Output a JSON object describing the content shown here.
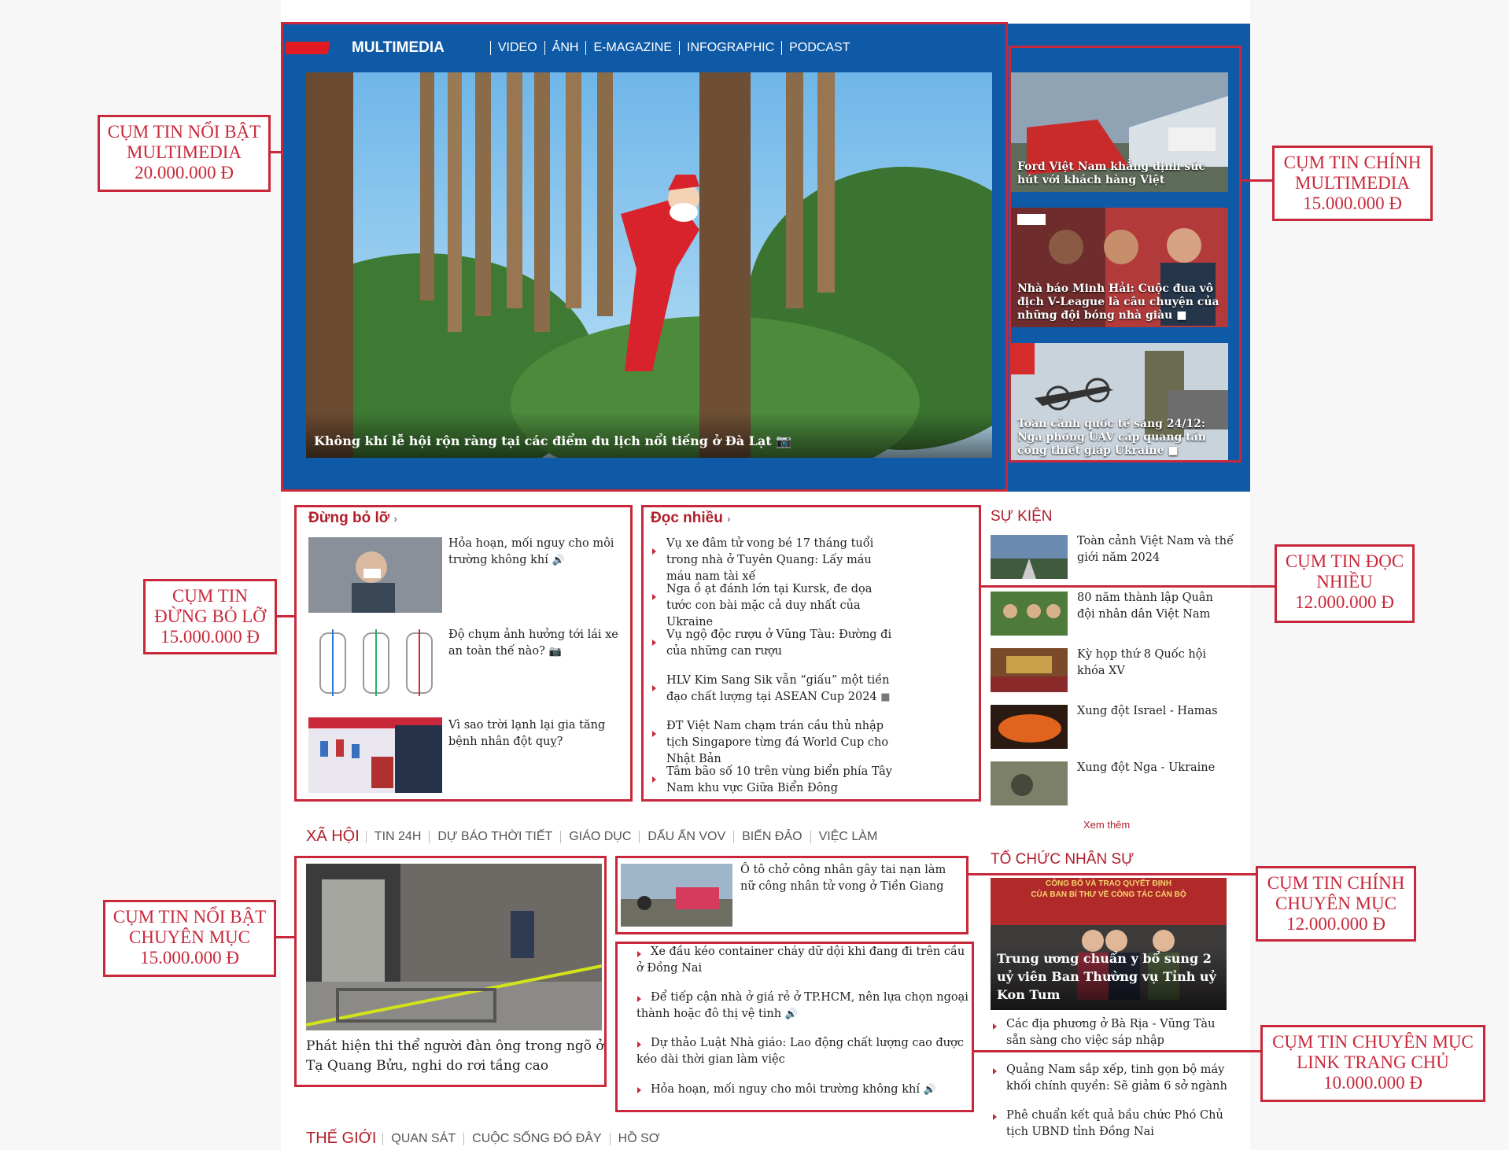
{
  "multimedia": {
    "title": "MULTIMEDIA",
    "nav": [
      "VIDEO",
      "ẢNH",
      "E-MAGAZINE",
      "INFOGRAPHIC",
      "PODCAST"
    ],
    "hero_caption": "Không khí lễ hội rộn ràng tại các điểm du lịch nổi tiếng ở Đà Lạt",
    "side": [
      {
        "title": "Ford Việt Nam khẳng định sức hút với khách hàng Việt"
      },
      {
        "title": "Nhà báo Minh Hải: Cuộc đua vô địch V-League là câu chuyện của những đội bóng nhà giàu"
      },
      {
        "title": "Toàn cảnh quốc tế sáng 24/12: Nga phóng UAV cáp quang tấn công thiết giáp Ukraine"
      }
    ]
  },
  "dung_bo_lo": {
    "heading": "Đừng bỏ lỡ",
    "items": [
      {
        "title": "Hỏa hoạn, mối nguy cho môi trường không khí"
      },
      {
        "title": "Độ chụm ảnh hưởng tới lái xe an toàn thế nào?"
      },
      {
        "title": "Vì sao trời lạnh lại gia tăng bệnh nhân đột quỵ?"
      }
    ]
  },
  "doc_nhieu": {
    "heading": "Đọc nhiều",
    "items": [
      "Vụ xe đâm tử vong bé 17 tháng tuổi trong nhà ở Tuyên Quang: Lấy máu máu nam tài xế",
      "Nga ồ ạt đánh lớn tại Kursk, đe dọa tước con bài mặc cả duy nhất của Ukraine",
      "Vụ ngộ độc rượu ở Vũng Tàu: Đường đi của những can rượu",
      "HLV Kim Sang Sik vẫn “giấu” một tiền đạo chất lượng tại ASEAN Cup 2024",
      "ĐT Việt Nam chạm trán cầu thủ nhập tịch Singapore từng đá World Cup cho Nhật Bản",
      "Tâm bão số 10 trên vùng biển phía Tây Nam khu vực Giữa Biển Đông"
    ]
  },
  "su_kien": {
    "heading": "SỰ KIỆN",
    "items": [
      "Toàn cảnh Việt Nam và thế giới năm 2024",
      "80 năm thành lập Quân đội nhân dân Việt Nam",
      "Kỳ họp thứ 8 Quốc hội khóa XV",
      "Xung đột Israel - Hamas",
      "Xung đột Nga - Ukraine"
    ],
    "more": "Xem thêm"
  },
  "xa_hoi": {
    "nav": [
      "XÃ HỘI",
      "TIN 24H",
      "DỰ BÁO THỜI TIẾT",
      "GIÁO DỤC",
      "DẤU ẤN VOV",
      "BIỂN ĐẢO",
      "VIỆC LÀM"
    ],
    "main_title": "Phát hiện thi thể người đàn ông trong ngõ ở Tạ Quang Bửu, nghi do rơi tầng cao",
    "second_title": "Ô tô chở công nhân gây tai nạn làm nữ công nhân tử vong ở Tiền Giang",
    "links": [
      "Xe đầu kéo container cháy dữ dội khi đang đi trên cầu ở Đồng Nai",
      "Để tiếp cận nhà ở giá rẻ ở TP.HCM, nên lựa chọn ngoại thành hoặc đô thị vệ tinh",
      "Dự thảo Luật Nhà giáo: Lao động chất lượng cao được kéo dài thời gian làm việc",
      "Hỏa hoạn, mối nguy cho môi trường không khí"
    ]
  },
  "to_chuc": {
    "heading": "TỔ CHỨC NHÂN SỰ",
    "banner_top": "CÔNG BỐ VÀ TRAO QUYẾT ĐỊNH",
    "banner_sub": "CỦA BAN BÍ THƯ VỀ CÔNG TÁC CÁN BỘ",
    "main_title": "Trung ương chuẩn y bổ sung 2 uỷ viên Ban Thường vụ Tỉnh uỷ Kon Tum",
    "links": [
      "Các địa phương ở Bà Rịa - Vũng Tàu sẵn sàng cho việc sáp nhập",
      "Quảng Nam sắp xếp, tinh gọn bộ máy khối chính quyền: Sẽ giảm 6 sở ngành",
      "Phê chuẩn kết quả bầu chức Phó Chủ tịch UBND tỉnh Đồng Nai"
    ]
  },
  "the_gioi": {
    "nav": [
      "THẾ GIỚI",
      "QUAN SÁT",
      "CUỘC SỐNG ĐÓ ĐÂY",
      "HỒ SƠ"
    ]
  },
  "callouts": [
    {
      "lines": [
        "CỤM TIN NỔI BẬT",
        "MULTIMEDIA",
        "20.000.000 Đ"
      ]
    },
    {
      "lines": [
        "CỤM TIN CHÍNH",
        "MULTIMEDIA",
        "15.000.000 Đ"
      ]
    },
    {
      "lines": [
        "CỤM TIN",
        "ĐỪNG BỎ LỠ",
        "15.000.000 Đ"
      ]
    },
    {
      "lines": [
        "CỤM TIN ĐỌC",
        "NHIỀU",
        "12.000.000 Đ"
      ]
    },
    {
      "lines": [
        "CỤM TIN NỔI BẬT",
        "CHUYÊN MỤC",
        "15.000.000 Đ"
      ]
    },
    {
      "lines": [
        "CỤM TIN CHÍNH",
        "CHUYÊN MỤC",
        "12.000.000 Đ"
      ]
    },
    {
      "lines": [
        "CỤM TIN CHUYÊN MỤC",
        "LINK TRANG CHỦ",
        "10.000.000 Đ"
      ]
    }
  ],
  "colors": {
    "accent": "#c8283a",
    "multimedia_bg": "#0f5aa6",
    "heading": "#b01e2a"
  }
}
